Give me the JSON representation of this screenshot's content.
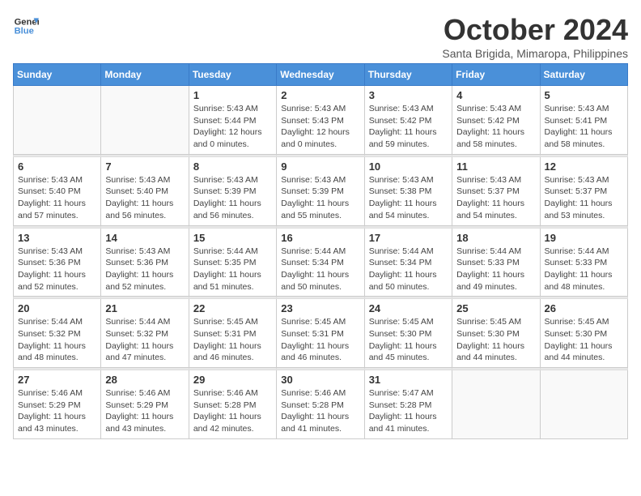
{
  "logo": {
    "line1": "General",
    "line2": "Blue"
  },
  "title": "October 2024",
  "subtitle": "Santa Brigida, Mimaropa, Philippines",
  "weekdays": [
    "Sunday",
    "Monday",
    "Tuesday",
    "Wednesday",
    "Thursday",
    "Friday",
    "Saturday"
  ],
  "weeks": [
    [
      {
        "day": "",
        "info": ""
      },
      {
        "day": "",
        "info": ""
      },
      {
        "day": "1",
        "info": "Sunrise: 5:43 AM\nSunset: 5:44 PM\nDaylight: 12 hours\nand 0 minutes."
      },
      {
        "day": "2",
        "info": "Sunrise: 5:43 AM\nSunset: 5:43 PM\nDaylight: 12 hours\nand 0 minutes."
      },
      {
        "day": "3",
        "info": "Sunrise: 5:43 AM\nSunset: 5:42 PM\nDaylight: 11 hours\nand 59 minutes."
      },
      {
        "day": "4",
        "info": "Sunrise: 5:43 AM\nSunset: 5:42 PM\nDaylight: 11 hours\nand 58 minutes."
      },
      {
        "day": "5",
        "info": "Sunrise: 5:43 AM\nSunset: 5:41 PM\nDaylight: 11 hours\nand 58 minutes."
      }
    ],
    [
      {
        "day": "6",
        "info": "Sunrise: 5:43 AM\nSunset: 5:40 PM\nDaylight: 11 hours\nand 57 minutes."
      },
      {
        "day": "7",
        "info": "Sunrise: 5:43 AM\nSunset: 5:40 PM\nDaylight: 11 hours\nand 56 minutes."
      },
      {
        "day": "8",
        "info": "Sunrise: 5:43 AM\nSunset: 5:39 PM\nDaylight: 11 hours\nand 56 minutes."
      },
      {
        "day": "9",
        "info": "Sunrise: 5:43 AM\nSunset: 5:39 PM\nDaylight: 11 hours\nand 55 minutes."
      },
      {
        "day": "10",
        "info": "Sunrise: 5:43 AM\nSunset: 5:38 PM\nDaylight: 11 hours\nand 54 minutes."
      },
      {
        "day": "11",
        "info": "Sunrise: 5:43 AM\nSunset: 5:37 PM\nDaylight: 11 hours\nand 54 minutes."
      },
      {
        "day": "12",
        "info": "Sunrise: 5:43 AM\nSunset: 5:37 PM\nDaylight: 11 hours\nand 53 minutes."
      }
    ],
    [
      {
        "day": "13",
        "info": "Sunrise: 5:43 AM\nSunset: 5:36 PM\nDaylight: 11 hours\nand 52 minutes."
      },
      {
        "day": "14",
        "info": "Sunrise: 5:43 AM\nSunset: 5:36 PM\nDaylight: 11 hours\nand 52 minutes."
      },
      {
        "day": "15",
        "info": "Sunrise: 5:44 AM\nSunset: 5:35 PM\nDaylight: 11 hours\nand 51 minutes."
      },
      {
        "day": "16",
        "info": "Sunrise: 5:44 AM\nSunset: 5:34 PM\nDaylight: 11 hours\nand 50 minutes."
      },
      {
        "day": "17",
        "info": "Sunrise: 5:44 AM\nSunset: 5:34 PM\nDaylight: 11 hours\nand 50 minutes."
      },
      {
        "day": "18",
        "info": "Sunrise: 5:44 AM\nSunset: 5:33 PM\nDaylight: 11 hours\nand 49 minutes."
      },
      {
        "day": "19",
        "info": "Sunrise: 5:44 AM\nSunset: 5:33 PM\nDaylight: 11 hours\nand 48 minutes."
      }
    ],
    [
      {
        "day": "20",
        "info": "Sunrise: 5:44 AM\nSunset: 5:32 PM\nDaylight: 11 hours\nand 48 minutes."
      },
      {
        "day": "21",
        "info": "Sunrise: 5:44 AM\nSunset: 5:32 PM\nDaylight: 11 hours\nand 47 minutes."
      },
      {
        "day": "22",
        "info": "Sunrise: 5:45 AM\nSunset: 5:31 PM\nDaylight: 11 hours\nand 46 minutes."
      },
      {
        "day": "23",
        "info": "Sunrise: 5:45 AM\nSunset: 5:31 PM\nDaylight: 11 hours\nand 46 minutes."
      },
      {
        "day": "24",
        "info": "Sunrise: 5:45 AM\nSunset: 5:30 PM\nDaylight: 11 hours\nand 45 minutes."
      },
      {
        "day": "25",
        "info": "Sunrise: 5:45 AM\nSunset: 5:30 PM\nDaylight: 11 hours\nand 44 minutes."
      },
      {
        "day": "26",
        "info": "Sunrise: 5:45 AM\nSunset: 5:30 PM\nDaylight: 11 hours\nand 44 minutes."
      }
    ],
    [
      {
        "day": "27",
        "info": "Sunrise: 5:46 AM\nSunset: 5:29 PM\nDaylight: 11 hours\nand 43 minutes."
      },
      {
        "day": "28",
        "info": "Sunrise: 5:46 AM\nSunset: 5:29 PM\nDaylight: 11 hours\nand 43 minutes."
      },
      {
        "day": "29",
        "info": "Sunrise: 5:46 AM\nSunset: 5:28 PM\nDaylight: 11 hours\nand 42 minutes."
      },
      {
        "day": "30",
        "info": "Sunrise: 5:46 AM\nSunset: 5:28 PM\nDaylight: 11 hours\nand 41 minutes."
      },
      {
        "day": "31",
        "info": "Sunrise: 5:47 AM\nSunset: 5:28 PM\nDaylight: 11 hours\nand 41 minutes."
      },
      {
        "day": "",
        "info": ""
      },
      {
        "day": "",
        "info": ""
      }
    ]
  ]
}
